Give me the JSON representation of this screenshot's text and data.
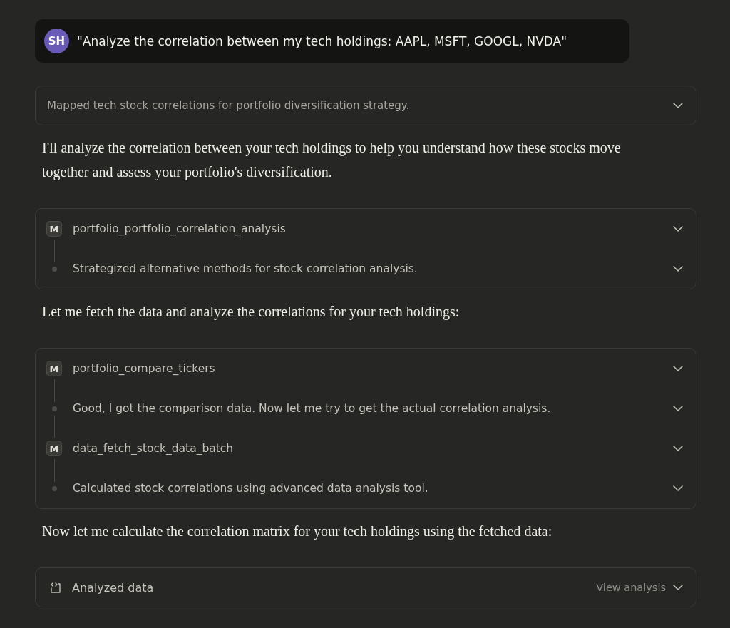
{
  "user_message": {
    "initials": "SH",
    "text": "\"Analyze the correlation between my tech holdings: AAPL, MSFT, GOOGL, NVDA\""
  },
  "blocks": [
    {
      "kind": "summary",
      "text": "Mapped tech stock correlations for portfolio diversification strategy.",
      "expanded": false
    },
    {
      "kind": "paragraph",
      "text": "I'll analyze the correlation between your tech holdings to help you understand how these stocks move together and assess your portfolio's diversification."
    },
    {
      "kind": "steps",
      "steps": [
        {
          "kind": "tool",
          "badge": "M",
          "text": "portfolio_portfolio_correlation_analysis",
          "expanded": false
        },
        {
          "kind": "thought",
          "text": "Strategized alternative methods for stock correlation analysis.",
          "expanded": false
        }
      ]
    },
    {
      "kind": "paragraph",
      "text": "Let me fetch the data and analyze the correlations for your tech holdings:"
    },
    {
      "kind": "steps",
      "steps": [
        {
          "kind": "tool",
          "badge": "M",
          "text": "portfolio_compare_tickers",
          "expanded": false
        },
        {
          "kind": "thought",
          "text": "Good, I got the comparison data. Now let me try to get the actual correlation analysis.",
          "expanded": false
        },
        {
          "kind": "tool",
          "badge": "M",
          "text": "data_fetch_stock_data_batch",
          "expanded": false
        },
        {
          "kind": "thought",
          "text": "Calculated stock correlations using advanced data analysis tool.",
          "expanded": false
        }
      ]
    },
    {
      "kind": "paragraph",
      "text": "Now let me calculate the correlation matrix for your tech holdings using the fetched data:"
    },
    {
      "kind": "artifact",
      "text": "Analyzed data",
      "action": "View analysis",
      "expanded": false
    }
  ]
}
